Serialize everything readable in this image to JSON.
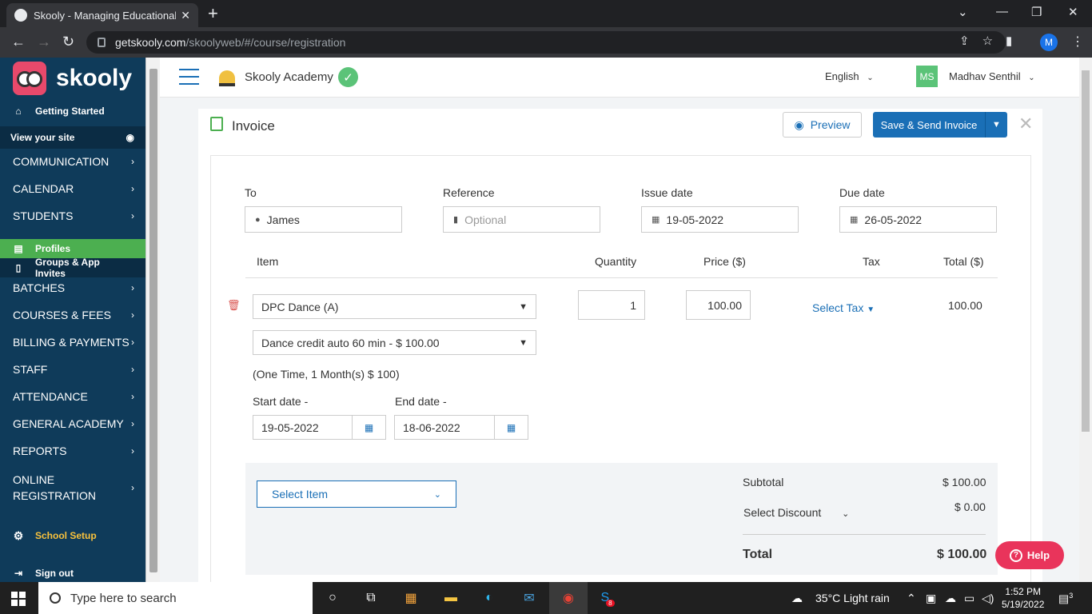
{
  "browser": {
    "tab_title": "Skooly - Managing Educational J",
    "url_host": "getskooly.com",
    "url_path": "/skoolyweb/#/course/registration",
    "profile_initial": "M"
  },
  "sidebar": {
    "brand": "skooly",
    "getting_started": "Getting Started",
    "view_site": "View your site",
    "items": [
      {
        "label": "COMMUNICATION"
      },
      {
        "label": "CALENDAR"
      },
      {
        "label": "STUDENTS"
      },
      {
        "label": "BATCHES"
      },
      {
        "label": "COURSES & FEES"
      },
      {
        "label": "BILLING & PAYMENTS"
      },
      {
        "label": "STAFF"
      },
      {
        "label": "ATTENDANCE"
      },
      {
        "label": "GENERAL ACADEMY"
      },
      {
        "label": "REPORTS"
      },
      {
        "label": "ONLINE REGISTRATION"
      }
    ],
    "sub_profiles": "Profiles",
    "sub_groups": "Groups & App Invites",
    "school_setup": "School Setup",
    "sign_out": "Sign out"
  },
  "topbar": {
    "academy": "Skooly Academy",
    "language": "English",
    "user_initials": "MS",
    "user_name": "Madhav Senthil"
  },
  "invoice": {
    "title": "Invoice",
    "preview_label": "Preview",
    "save_send_label": "Save & Send Invoice",
    "to_label": "To",
    "to_value": "James",
    "reference_label": "Reference",
    "reference_placeholder": "Optional",
    "issue_label": "Issue date",
    "issue_value": "19-05-2022",
    "due_label": "Due date",
    "due_value": "26-05-2022",
    "columns": {
      "item": "Item",
      "quantity": "Quantity",
      "price": "Price ($)",
      "tax": "Tax",
      "total": "Total ($)"
    },
    "line": {
      "item": "DPC Dance (A)",
      "plan": "Dance credit auto 60 min - $ 100.00",
      "quantity": "1",
      "price": "100.00",
      "tax_link": "Select Tax",
      "total": "100.00",
      "note": "(One Time, 1 Month(s) $ 100)",
      "start_label": "Start date -",
      "start_value": "19-05-2022",
      "end_label": "End date -",
      "end_value": "18-06-2022"
    },
    "select_item": "Select Item",
    "subtotal_label": "Subtotal",
    "subtotal_value": "$ 100.00",
    "discount_link": "Select Discount",
    "discount_value": "$ 0.00",
    "total_label": "Total",
    "total_value": "$ 100.00"
  },
  "help_label": "Help",
  "taskbar": {
    "search_placeholder": "Type here to search",
    "weather": "35°C  Light rain",
    "time": "1:52 PM",
    "date": "5/19/2022",
    "notif_count": "3",
    "skype_badge": "8"
  }
}
